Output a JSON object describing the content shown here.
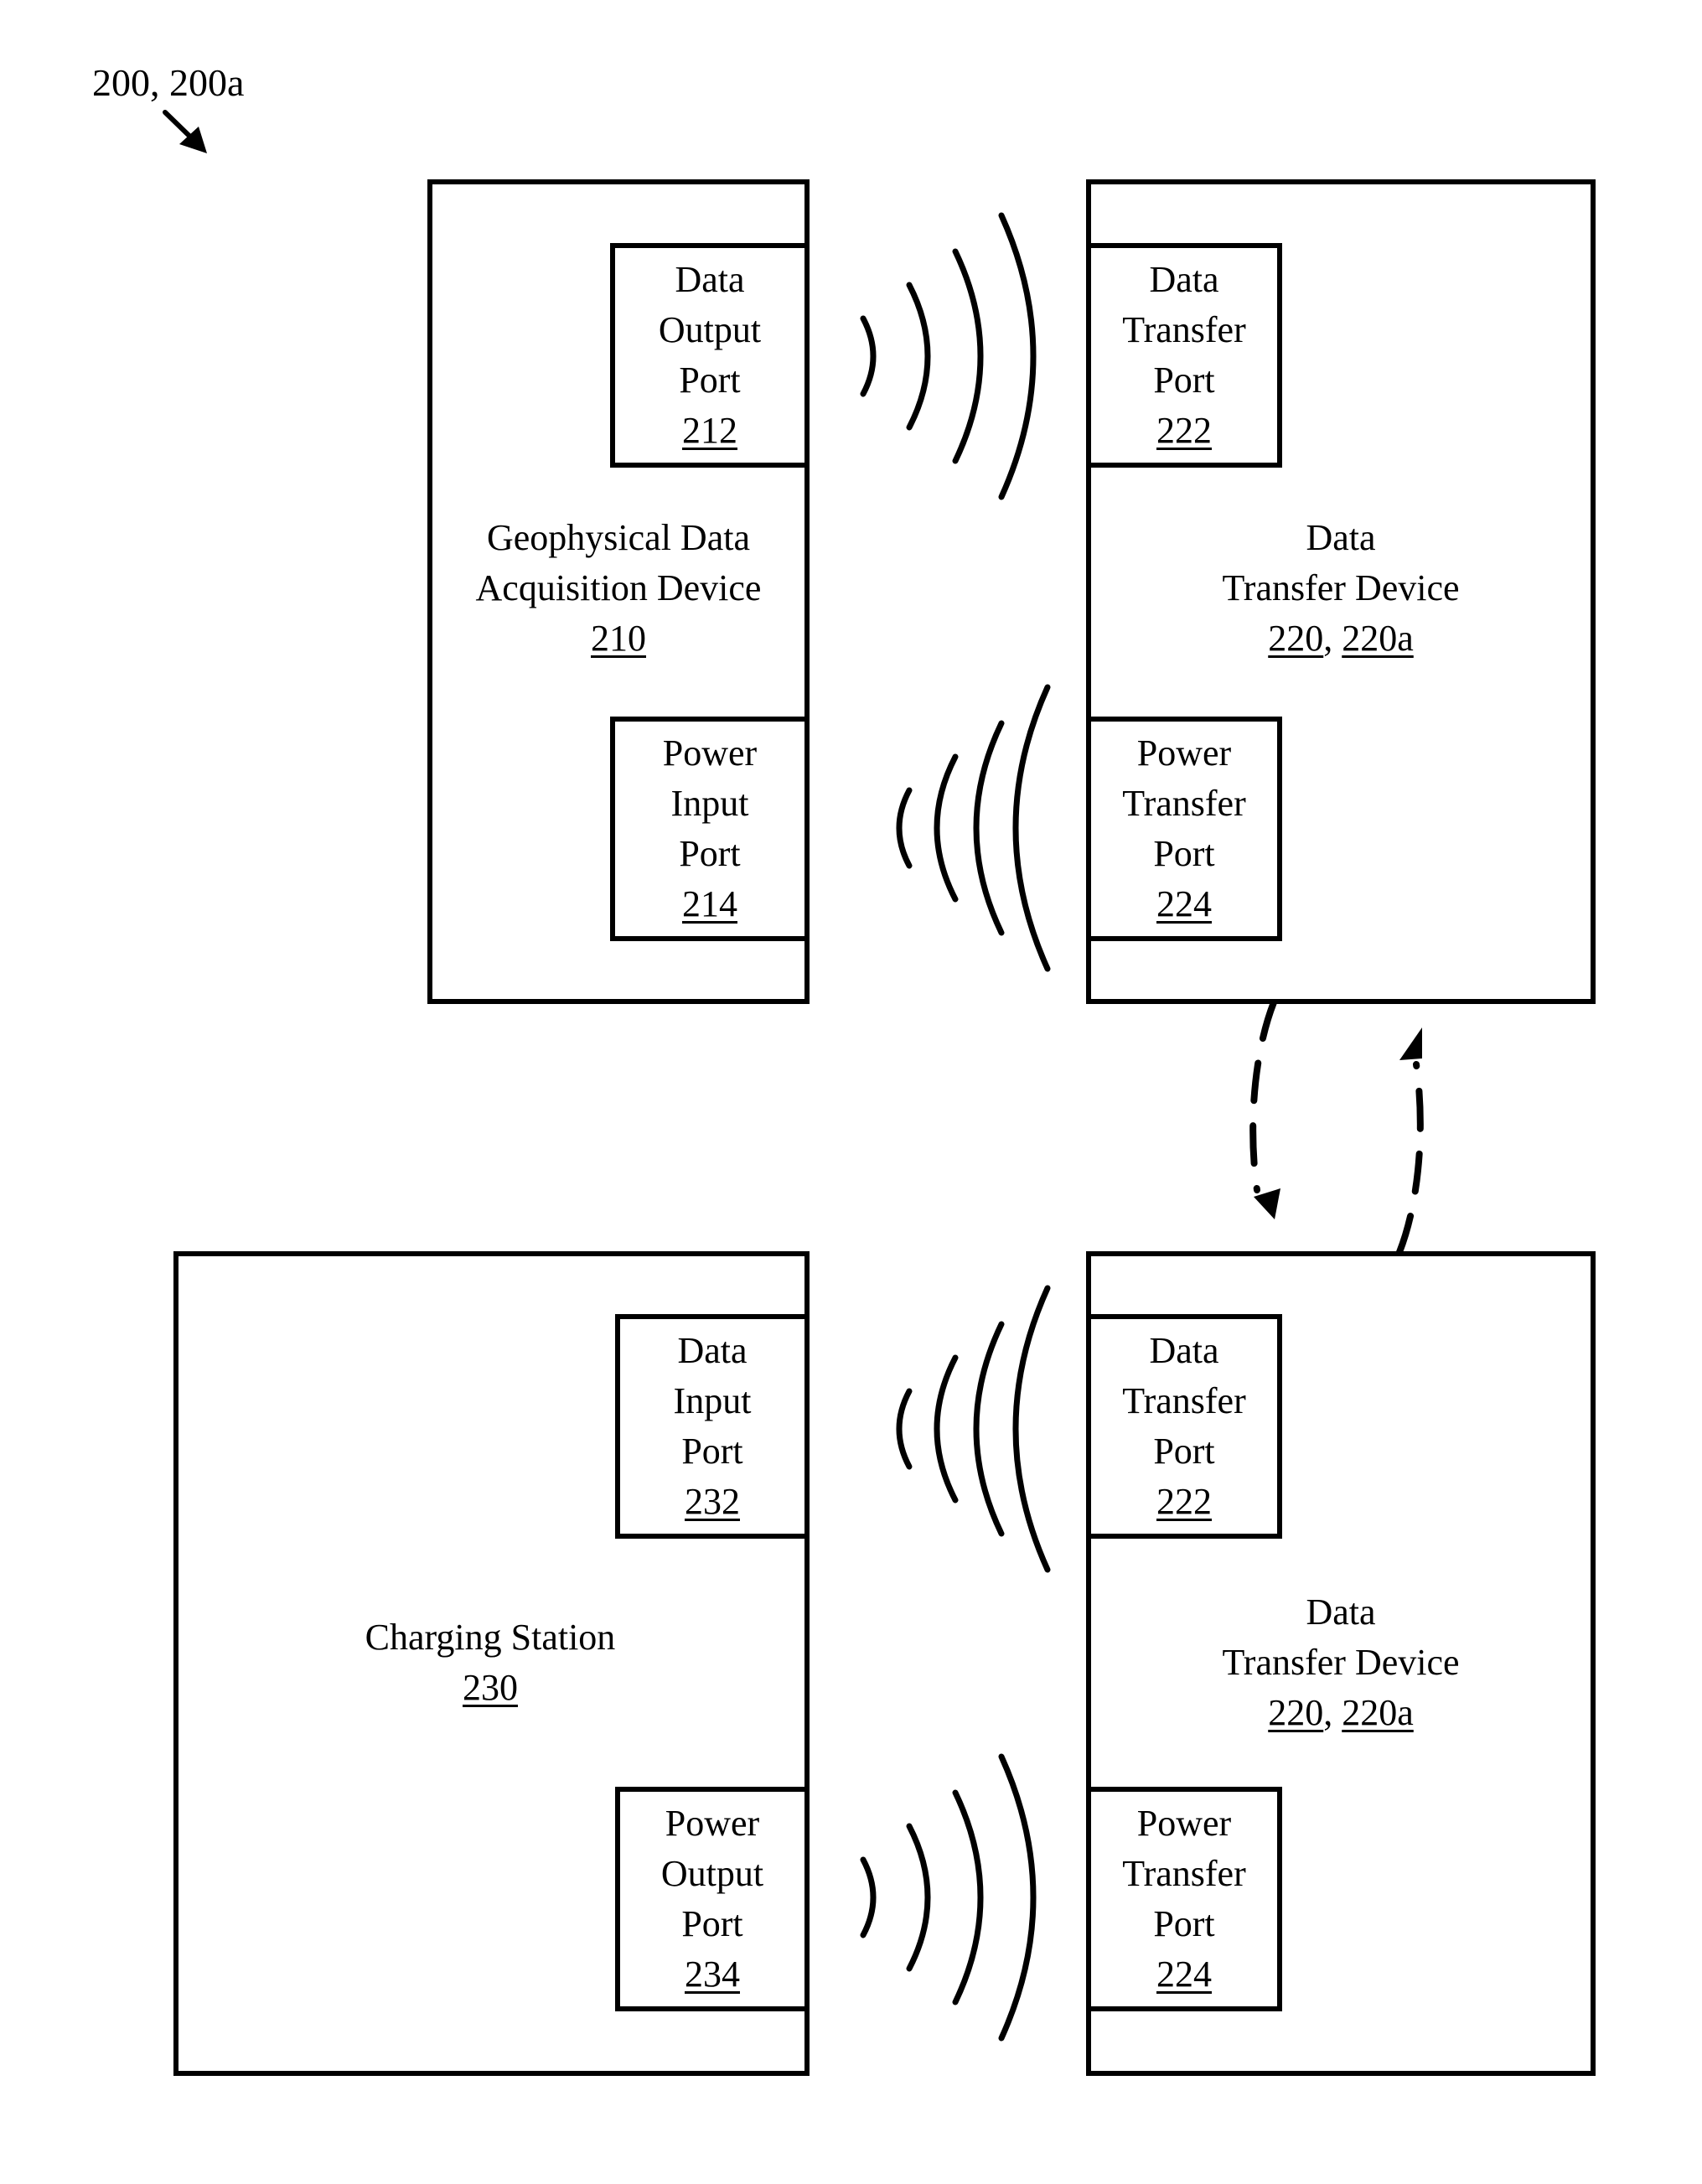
{
  "figure": {
    "label": "200, 200a"
  },
  "devices": {
    "acquisition": {
      "name_line1": "Geophysical Data",
      "name_line2": "Acquisition Device",
      "ref": "210",
      "ports": {
        "data": {
          "line1": "Data",
          "line2": "Output",
          "line3": "Port",
          "ref": "212"
        },
        "power": {
          "line1": "Power",
          "line2": "Input",
          "line3": "Port",
          "ref": "214"
        }
      }
    },
    "transfer_top": {
      "name_line1": "Data",
      "name_line2": "Transfer Device",
      "ref_a": "220",
      "separator": ", ",
      "ref_b": "220a",
      "ports": {
        "data": {
          "line1": "Data",
          "line2": "Transfer",
          "line3": "Port",
          "ref": "222"
        },
        "power": {
          "line1": "Power",
          "line2": "Transfer",
          "line3": "Port",
          "ref": "224"
        }
      }
    },
    "charging": {
      "name_line1": "Charging Station",
      "ref": "230",
      "ports": {
        "data": {
          "line1": "Data",
          "line2": "Input",
          "line3": "Port",
          "ref": "232"
        },
        "power": {
          "line1": "Power",
          "line2": "Output",
          "line3": "Port",
          "ref": "234"
        }
      }
    },
    "transfer_bottom": {
      "name_line1": "Data",
      "name_line2": "Transfer Device",
      "ref_a": "220",
      "separator": ", ",
      "ref_b": "220a",
      "ports": {
        "data": {
          "line1": "Data",
          "line2": "Transfer",
          "line3": "Port",
          "ref": "222"
        },
        "power": {
          "line1": "Power",
          "line2": "Transfer",
          "line3": "Port",
          "ref": "224"
        }
      }
    }
  },
  "wireless_links": [
    {
      "name": "data-link-top",
      "direction": "right",
      "from": "212",
      "to": "222"
    },
    {
      "name": "power-link-top",
      "direction": "left",
      "from": "224",
      "to": "214"
    },
    {
      "name": "data-link-bottom",
      "direction": "left",
      "from": "222",
      "to": "232"
    },
    {
      "name": "power-link-bottom",
      "direction": "right",
      "from": "234",
      "to": "224"
    }
  ],
  "movement_arrows": [
    {
      "name": "move-down-arrow",
      "style": "dashed",
      "direction": "down"
    },
    {
      "name": "move-up-arrow",
      "style": "dashed",
      "direction": "up"
    }
  ]
}
